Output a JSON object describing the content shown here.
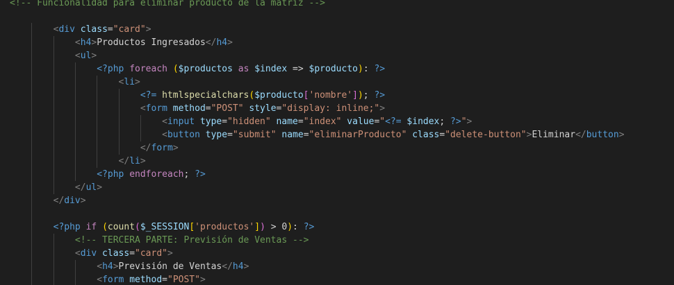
{
  "colors": {
    "background": "#1e1e1e",
    "indent_guide": "#404040",
    "comment": "#6a9955",
    "tag": "#569cd6",
    "bracket": "#808080",
    "attribute": "#9cdcfe",
    "string": "#ce9178",
    "php_delim": "#569cd6",
    "keyword": "#c586c0",
    "variable": "#9cdcfe",
    "function": "#dcdcaa",
    "punct": "#d4d4d4",
    "paren": "#ffd700",
    "paren2": "#da70d6",
    "text": "#d4d4d4"
  },
  "lines": [
    {
      "indent": 0,
      "tokens": [
        {
          "t": "<!-- Funcionalidad para eliminar producto de la matriz -->",
          "c": "comment"
        }
      ]
    },
    {
      "indent": 0,
      "tokens": []
    },
    {
      "indent": 2,
      "tokens": [
        {
          "t": "<",
          "c": "bracket"
        },
        {
          "t": "div",
          "c": "tag"
        },
        {
          "t": " class",
          "c": "attribute"
        },
        {
          "t": "=",
          "c": "punct"
        },
        {
          "t": "\"card\"",
          "c": "string"
        },
        {
          "t": ">",
          "c": "bracket"
        }
      ]
    },
    {
      "indent": 3,
      "tokens": [
        {
          "t": "<",
          "c": "bracket"
        },
        {
          "t": "h4",
          "c": "tag"
        },
        {
          "t": ">",
          "c": "bracket"
        },
        {
          "t": "Productos Ingresados",
          "c": "text"
        },
        {
          "t": "</",
          "c": "bracket"
        },
        {
          "t": "h4",
          "c": "tag"
        },
        {
          "t": ">",
          "c": "bracket"
        }
      ]
    },
    {
      "indent": 3,
      "tokens": [
        {
          "t": "<",
          "c": "bracket"
        },
        {
          "t": "ul",
          "c": "tag"
        },
        {
          "t": ">",
          "c": "bracket"
        }
      ]
    },
    {
      "indent": 4,
      "tokens": [
        {
          "t": "<?php",
          "c": "php_delim"
        },
        {
          "t": " foreach ",
          "c": "keyword"
        },
        {
          "t": "(",
          "c": "paren"
        },
        {
          "t": "$productos",
          "c": "variable"
        },
        {
          "t": " as ",
          "c": "keyword"
        },
        {
          "t": "$index",
          "c": "variable"
        },
        {
          "t": " => ",
          "c": "punct"
        },
        {
          "t": "$producto",
          "c": "variable"
        },
        {
          "t": ")",
          "c": "paren"
        },
        {
          "t": ": ",
          "c": "punct"
        },
        {
          "t": "?>",
          "c": "php_delim"
        }
      ]
    },
    {
      "indent": 5,
      "tokens": [
        {
          "t": "<",
          "c": "bracket"
        },
        {
          "t": "li",
          "c": "tag"
        },
        {
          "t": ">",
          "c": "bracket"
        }
      ]
    },
    {
      "indent": 6,
      "tokens": [
        {
          "t": "<?=",
          "c": "php_delim"
        },
        {
          "t": " htmlspecialchars",
          "c": "function"
        },
        {
          "t": "(",
          "c": "paren"
        },
        {
          "t": "$producto",
          "c": "variable"
        },
        {
          "t": "[",
          "c": "paren2"
        },
        {
          "t": "'nombre'",
          "c": "string"
        },
        {
          "t": "]",
          "c": "paren2"
        },
        {
          "t": ")",
          "c": "paren"
        },
        {
          "t": "; ",
          "c": "punct"
        },
        {
          "t": "?>",
          "c": "php_delim"
        }
      ]
    },
    {
      "indent": 6,
      "tokens": [
        {
          "t": "<",
          "c": "bracket"
        },
        {
          "t": "form",
          "c": "tag"
        },
        {
          "t": " method",
          "c": "attribute"
        },
        {
          "t": "=",
          "c": "punct"
        },
        {
          "t": "\"POST\"",
          "c": "string"
        },
        {
          "t": " style",
          "c": "attribute"
        },
        {
          "t": "=",
          "c": "punct"
        },
        {
          "t": "\"display: inline;\"",
          "c": "string"
        },
        {
          "t": ">",
          "c": "bracket"
        }
      ]
    },
    {
      "indent": 7,
      "tokens": [
        {
          "t": "<",
          "c": "bracket"
        },
        {
          "t": "input",
          "c": "tag"
        },
        {
          "t": " type",
          "c": "attribute"
        },
        {
          "t": "=",
          "c": "punct"
        },
        {
          "t": "\"hidden\"",
          "c": "string"
        },
        {
          "t": " name",
          "c": "attribute"
        },
        {
          "t": "=",
          "c": "punct"
        },
        {
          "t": "\"index\"",
          "c": "string"
        },
        {
          "t": " value",
          "c": "attribute"
        },
        {
          "t": "=",
          "c": "punct"
        },
        {
          "t": "\"",
          "c": "string"
        },
        {
          "t": "<?=",
          "c": "php_delim"
        },
        {
          "t": " $index",
          "c": "variable"
        },
        {
          "t": "; ",
          "c": "punct"
        },
        {
          "t": "?>",
          "c": "php_delim"
        },
        {
          "t": "\"",
          "c": "string"
        },
        {
          "t": ">",
          "c": "bracket"
        }
      ]
    },
    {
      "indent": 7,
      "tokens": [
        {
          "t": "<",
          "c": "bracket"
        },
        {
          "t": "button",
          "c": "tag"
        },
        {
          "t": " type",
          "c": "attribute"
        },
        {
          "t": "=",
          "c": "punct"
        },
        {
          "t": "\"submit\"",
          "c": "string"
        },
        {
          "t": " name",
          "c": "attribute"
        },
        {
          "t": "=",
          "c": "punct"
        },
        {
          "t": "\"eliminarProducto\"",
          "c": "string"
        },
        {
          "t": " class",
          "c": "attribute"
        },
        {
          "t": "=",
          "c": "punct"
        },
        {
          "t": "\"delete-button\"",
          "c": "string"
        },
        {
          "t": ">",
          "c": "bracket"
        },
        {
          "t": "Eliminar",
          "c": "text"
        },
        {
          "t": "</",
          "c": "bracket"
        },
        {
          "t": "button",
          "c": "tag"
        },
        {
          "t": ">",
          "c": "bracket"
        }
      ]
    },
    {
      "indent": 6,
      "tokens": [
        {
          "t": "</",
          "c": "bracket"
        },
        {
          "t": "form",
          "c": "tag"
        },
        {
          "t": ">",
          "c": "bracket"
        }
      ]
    },
    {
      "indent": 5,
      "tokens": [
        {
          "t": "</",
          "c": "bracket"
        },
        {
          "t": "li",
          "c": "tag"
        },
        {
          "t": ">",
          "c": "bracket"
        }
      ]
    },
    {
      "indent": 4,
      "tokens": [
        {
          "t": "<?php",
          "c": "php_delim"
        },
        {
          "t": " endforeach",
          "c": "keyword"
        },
        {
          "t": "; ",
          "c": "punct"
        },
        {
          "t": "?>",
          "c": "php_delim"
        }
      ]
    },
    {
      "indent": 3,
      "tokens": [
        {
          "t": "</",
          "c": "bracket"
        },
        {
          "t": "ul",
          "c": "tag"
        },
        {
          "t": ">",
          "c": "bracket"
        }
      ]
    },
    {
      "indent": 2,
      "tokens": [
        {
          "t": "</",
          "c": "bracket"
        },
        {
          "t": "div",
          "c": "tag"
        },
        {
          "t": ">",
          "c": "bracket"
        }
      ]
    },
    {
      "indent": 2,
      "tokens": []
    },
    {
      "indent": 2,
      "tokens": [
        {
          "t": "<?php",
          "c": "php_delim"
        },
        {
          "t": " if ",
          "c": "keyword"
        },
        {
          "t": "(",
          "c": "paren"
        },
        {
          "t": "count",
          "c": "function"
        },
        {
          "t": "(",
          "c": "paren2"
        },
        {
          "t": "$_SESSION",
          "c": "variable"
        },
        {
          "t": "[",
          "c": "paren"
        },
        {
          "t": "'productos'",
          "c": "string"
        },
        {
          "t": "]",
          "c": "paren"
        },
        {
          "t": ")",
          "c": "paren2"
        },
        {
          "t": " > 0",
          "c": "punct"
        },
        {
          "t": ")",
          "c": "paren"
        },
        {
          "t": ": ",
          "c": "punct"
        },
        {
          "t": "?>",
          "c": "php_delim"
        }
      ]
    },
    {
      "indent": 3,
      "tokens": [
        {
          "t": "<!-- TERCERA PARTE: Previsión de Ventas -->",
          "c": "comment"
        }
      ]
    },
    {
      "indent": 3,
      "tokens": [
        {
          "t": "<",
          "c": "bracket"
        },
        {
          "t": "div",
          "c": "tag"
        },
        {
          "t": " class",
          "c": "attribute"
        },
        {
          "t": "=",
          "c": "punct"
        },
        {
          "t": "\"card\"",
          "c": "string"
        },
        {
          "t": ">",
          "c": "bracket"
        }
      ]
    },
    {
      "indent": 4,
      "tokens": [
        {
          "t": "<",
          "c": "bracket"
        },
        {
          "t": "h4",
          "c": "tag"
        },
        {
          "t": ">",
          "c": "bracket"
        },
        {
          "t": "Previsión de Ventas",
          "c": "text"
        },
        {
          "t": "</",
          "c": "bracket"
        },
        {
          "t": "h4",
          "c": "tag"
        },
        {
          "t": ">",
          "c": "bracket"
        }
      ]
    },
    {
      "indent": 4,
      "tokens": [
        {
          "t": "<",
          "c": "bracket"
        },
        {
          "t": "form",
          "c": "tag"
        },
        {
          "t": " method",
          "c": "attribute"
        },
        {
          "t": "=",
          "c": "punct"
        },
        {
          "t": "\"POST\"",
          "c": "string"
        },
        {
          "t": ">",
          "c": "bracket"
        }
      ]
    }
  ]
}
